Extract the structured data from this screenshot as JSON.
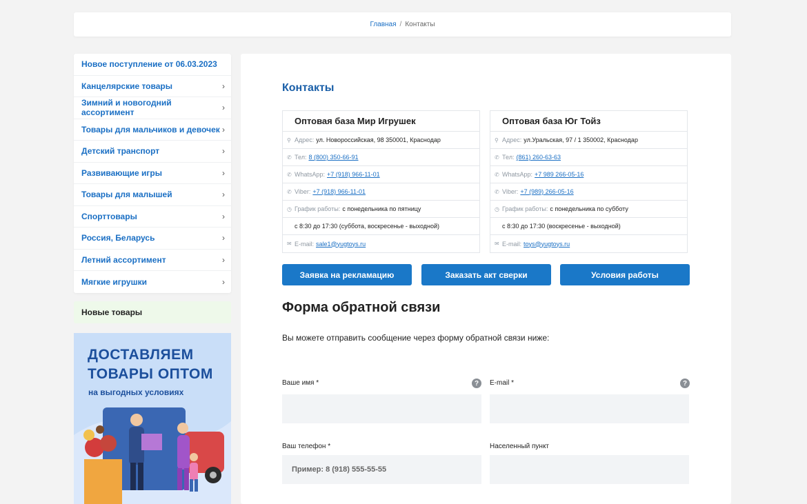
{
  "breadcrumb": {
    "home": "Главная",
    "separator": "/",
    "current": "Контакты"
  },
  "sidebar": {
    "items": [
      {
        "label": "Новое поступление от 06.03.2023",
        "chevron": ""
      },
      {
        "label": "Канцелярские товары",
        "chevron": "›"
      },
      {
        "label": "Зимний и новогодний ассортимент",
        "chevron": "›"
      },
      {
        "label": "Товары для мальчиков и девочек",
        "chevron": "›"
      },
      {
        "label": "Детский транспорт",
        "chevron": "›"
      },
      {
        "label": "Развивающие игры",
        "chevron": "›"
      },
      {
        "label": "Товары для малышей",
        "chevron": "›"
      },
      {
        "label": "Спорттовары",
        "chevron": "›"
      },
      {
        "label": "Россия, Беларусь",
        "chevron": "›"
      },
      {
        "label": "Летний ассортимент",
        "chevron": "›"
      },
      {
        "label": "Мягкие игрушки",
        "chevron": "›"
      }
    ],
    "new_goods": "Новые товары",
    "banner": {
      "line1": "ДОСТАВЛЯЕМ",
      "line2": "ТОВАРЫ ОПТОМ",
      "line3": "на выгодных условиях"
    }
  },
  "contacts": {
    "title": "Контакты",
    "left": {
      "name": "Оптовая база Мир Игрушек",
      "address_label": "Адрес:",
      "address": "ул. Новороссийская, 98 350001, Краснодар",
      "phone_label": "Тел:",
      "phone": "8 (800) 350-66-91",
      "whatsapp_label": "WhatsApp:",
      "whatsapp": "+7 (918) 966-11-01",
      "viber_label": "Viber:",
      "viber": "+7 (918) 966-11-01",
      "schedule_label": "График работы:",
      "schedule": "с понедельника по пятницу",
      "schedule2": "с 8:30 до 17:30 (суббота, воскресенье - выходной)",
      "email_label": "E-mail:",
      "email": "sale1@yugtoys.ru"
    },
    "right": {
      "name": "Оптовая база Юг Тойз",
      "address_label": "Адрес:",
      "address": "ул.Уральская, 97 / 1 350002, Краснодар",
      "phone_label": "Тел:",
      "phone": "(861) 260-63-63",
      "whatsapp_label": "WhatsApp:",
      "whatsapp": "+7 989 266-05-16",
      "viber_label": "Viber:",
      "viber": "+7 (989) 266-05-16",
      "schedule_label": "График работы:",
      "schedule": "с понедельника по субботу",
      "schedule2": "с 8:30 до 17:30 (воскресенье - выходной)",
      "email_label": "E-mail:",
      "email": "toys@yugtoys.ru"
    }
  },
  "buttons": {
    "complaint": "Заявка на рекламацию",
    "reconciliation": "Заказать акт сверки",
    "terms": "Условия работы"
  },
  "form": {
    "title": "Форма обратной связи",
    "description": "Вы можете отправить сообщение через форму обратной связи ниже:",
    "name_label": "Ваше имя *",
    "email_label": "E-mail *",
    "phone_label": "Ваш телефон *",
    "phone_placeholder": "Пример: 8 (918) 555-55-55",
    "city_label": "Населенный пункт",
    "help_glyph": "?"
  },
  "icons": {
    "address": "location-pin-icon",
    "phone": "phone-icon",
    "whatsapp": "whatsapp-icon",
    "viber": "viber-icon",
    "schedule": "clock-icon",
    "email": "envelope-icon"
  },
  "colors": {
    "accent": "#1a78c8",
    "link": "#1a6fc4",
    "heading_blue": "#1a5fa8",
    "new_goods_bg": "#eef9ea",
    "banner_bg": "#c9def8"
  }
}
